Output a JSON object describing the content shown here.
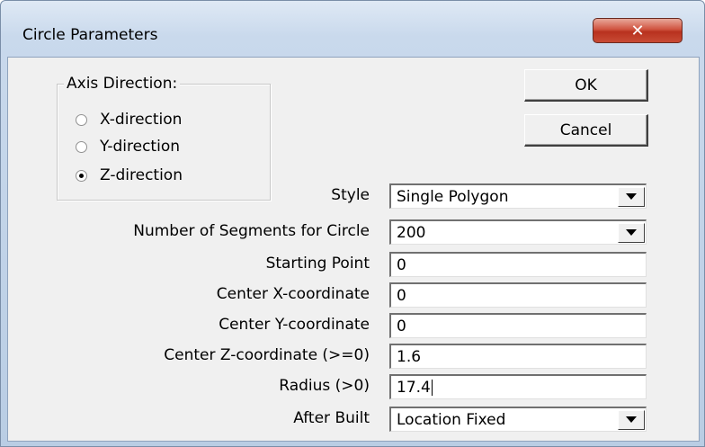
{
  "window": {
    "title": "Circle Parameters",
    "close_label": "✕"
  },
  "axis_direction": {
    "legend": "Axis Direction:",
    "options": [
      {
        "label": "X-direction",
        "checked": false
      },
      {
        "label": "Y-direction",
        "checked": false
      },
      {
        "label": "Z-direction",
        "checked": true
      }
    ]
  },
  "buttons": {
    "ok_label": "OK",
    "cancel_label": "Cancel"
  },
  "fields": {
    "style": {
      "label": "Style",
      "value": "Single Polygon"
    },
    "segments": {
      "label": "Number of Segments for Circle",
      "value": "200"
    },
    "starting_point": {
      "label": "Starting Point",
      "value": "0"
    },
    "center_x": {
      "label": "Center X-coordinate",
      "value": "0"
    },
    "center_y": {
      "label": "Center Y-coordinate",
      "value": "0"
    },
    "center_z": {
      "label": "Center Z-coordinate (>=0)",
      "value": "1.6"
    },
    "radius": {
      "label": "Radius (>0)",
      "value": "17.4"
    },
    "after_built": {
      "label": "After Built",
      "value": "Location Fixed"
    }
  }
}
